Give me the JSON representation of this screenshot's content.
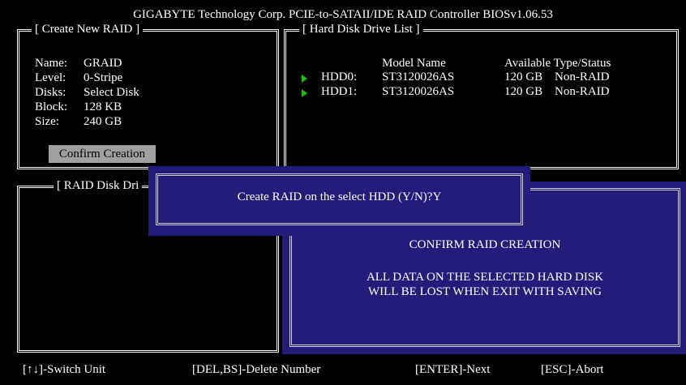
{
  "title": "GIGABYTE Technology Corp. PCIE-to-SATAII/IDE RAID Controller BIOSv1.06.53",
  "create_panel": {
    "label": "[ Create New RAID ]",
    "fields": [
      {
        "key": "Name:",
        "value": "GRAID"
      },
      {
        "key": "Level:",
        "value": "0-Stripe"
      },
      {
        "key": "Disks:",
        "value": "Select Disk"
      },
      {
        "key": "Block:",
        "value": "128 KB"
      },
      {
        "key": "Size:",
        "value": "240 GB"
      }
    ],
    "confirm_label": "Confirm Creation"
  },
  "hdd_panel": {
    "label": "[ Hard Disk Drive List ]",
    "columns": {
      "model": "Model Name",
      "status": "Available Type/Status"
    },
    "rows": [
      {
        "id": "HDD0:",
        "model": "ST3120026AS",
        "size": "120 GB",
        "status": "Non-RAID"
      },
      {
        "id": "HDD1:",
        "model": "ST3120026AS",
        "size": "120 GB",
        "status": "Non-RAID"
      }
    ]
  },
  "raid_list": {
    "label": "[ RAID Disk Dri"
  },
  "dialog": {
    "prompt": "Create RAID on the select HDD (Y/N)?Y"
  },
  "confirm_box": {
    "heading": "CONFIRM RAID CREATION",
    "line1": "ALL DATA ON THE SELECTED HARD DISK",
    "line2": "WILL BE LOST WHEN EXIT WITH SAVING"
  },
  "footer": {
    "switch": "[↑↓]-Switch Unit",
    "delete": "[DEL,BS]-Delete Number",
    "next": "[ENTER]-Next",
    "abort": "[ESC]-Abort"
  },
  "colors": {
    "background": "#000000",
    "dialog_blue": "#241c7a",
    "arrow_green": "#1ec01e",
    "button_gray": "#a0a0a0"
  }
}
